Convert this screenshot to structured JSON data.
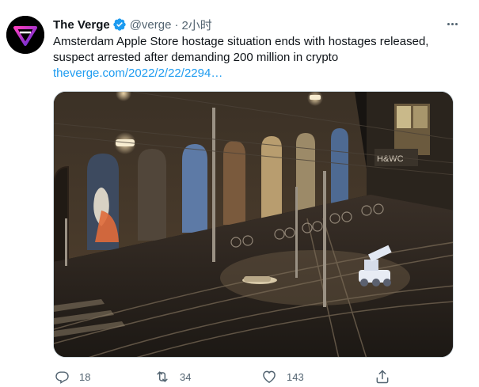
{
  "tweet": {
    "author_name": "The Verge",
    "handle": "@verge",
    "separator": "·",
    "time": "2小时",
    "text_line1": "Amsterdam Apple Store hostage situation ends with hostages released,",
    "text_line2": "suspect arrested after demanding 200 million in crypto",
    "link": "theverge.com/2022/2/22/2294…",
    "media_signage": "H&WC"
  },
  "actions": {
    "reply_count": "18",
    "retweet_count": "34",
    "like_count": "143"
  },
  "colors": {
    "link": "#1d9bf0",
    "secondary_text": "#536471",
    "verified": "#1d9bf0",
    "logo_gradient_start": "#ff3fbf",
    "logo_gradient_end": "#5b2bd6"
  }
}
